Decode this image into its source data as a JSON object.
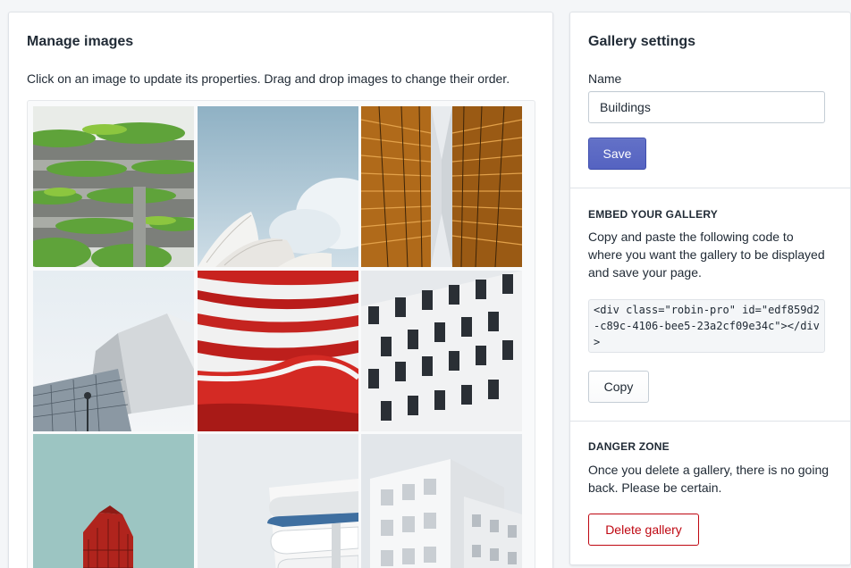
{
  "manage": {
    "title": "Manage images",
    "help": "Click on an image to update its properties. Drag and drop images to change their order.",
    "images": [
      {
        "subject": "green-terraced-building"
      },
      {
        "subject": "opera-house-sky"
      },
      {
        "subject": "gold-glass-towers"
      },
      {
        "subject": "angular-glass-building"
      },
      {
        "subject": "red-white-curves"
      },
      {
        "subject": "checkered-facade"
      },
      {
        "subject": "red-tower-teal-sky"
      },
      {
        "subject": "white-curved-balconies"
      },
      {
        "subject": "white-modular-building"
      }
    ]
  },
  "settings": {
    "title": "Gallery settings",
    "name_label": "Name",
    "name_value": "Buildings",
    "save_label": "Save"
  },
  "embed": {
    "title": "EMBED YOUR GALLERY",
    "text": "Copy and paste the following code to where you want the gallery to be displayed and save your page.",
    "code": "<div class=\"robin-pro\" id=\"edf859d2-c89c-4106-bee5-23a2cf09e34c\"></div>",
    "copy_label": "Copy"
  },
  "danger": {
    "title": "DANGER ZONE",
    "text": "Once you delete a gallery, there is no going back. Please be certain.",
    "delete_label": "Delete gallery"
  },
  "colors": {
    "primary": "#5c6ac4",
    "danger": "#bf0711",
    "background": "#f4f6f8"
  }
}
